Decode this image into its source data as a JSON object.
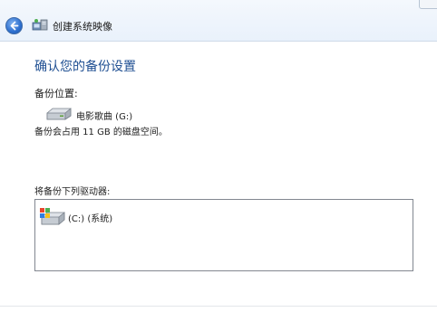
{
  "window": {
    "title": "创建系统映像"
  },
  "icons": {
    "back": "back-arrow-icon",
    "app": "backup-app-icon",
    "drive": "drive-icon",
    "system_drive": "windows-system-drive-icon"
  },
  "page": {
    "heading": "确认您的备份设置",
    "location_label": "备份位置:",
    "location_drive": "电影歌曲 (G:)",
    "usage_text": "备份会占用 11 GB 的磁盘空间。",
    "drives_label": "将备份下列驱动器:",
    "drives": [
      {
        "label": "(C:) (系统)"
      }
    ]
  },
  "colors": {
    "heading": "#1f4f92",
    "back_button": "#2d6fcf"
  }
}
